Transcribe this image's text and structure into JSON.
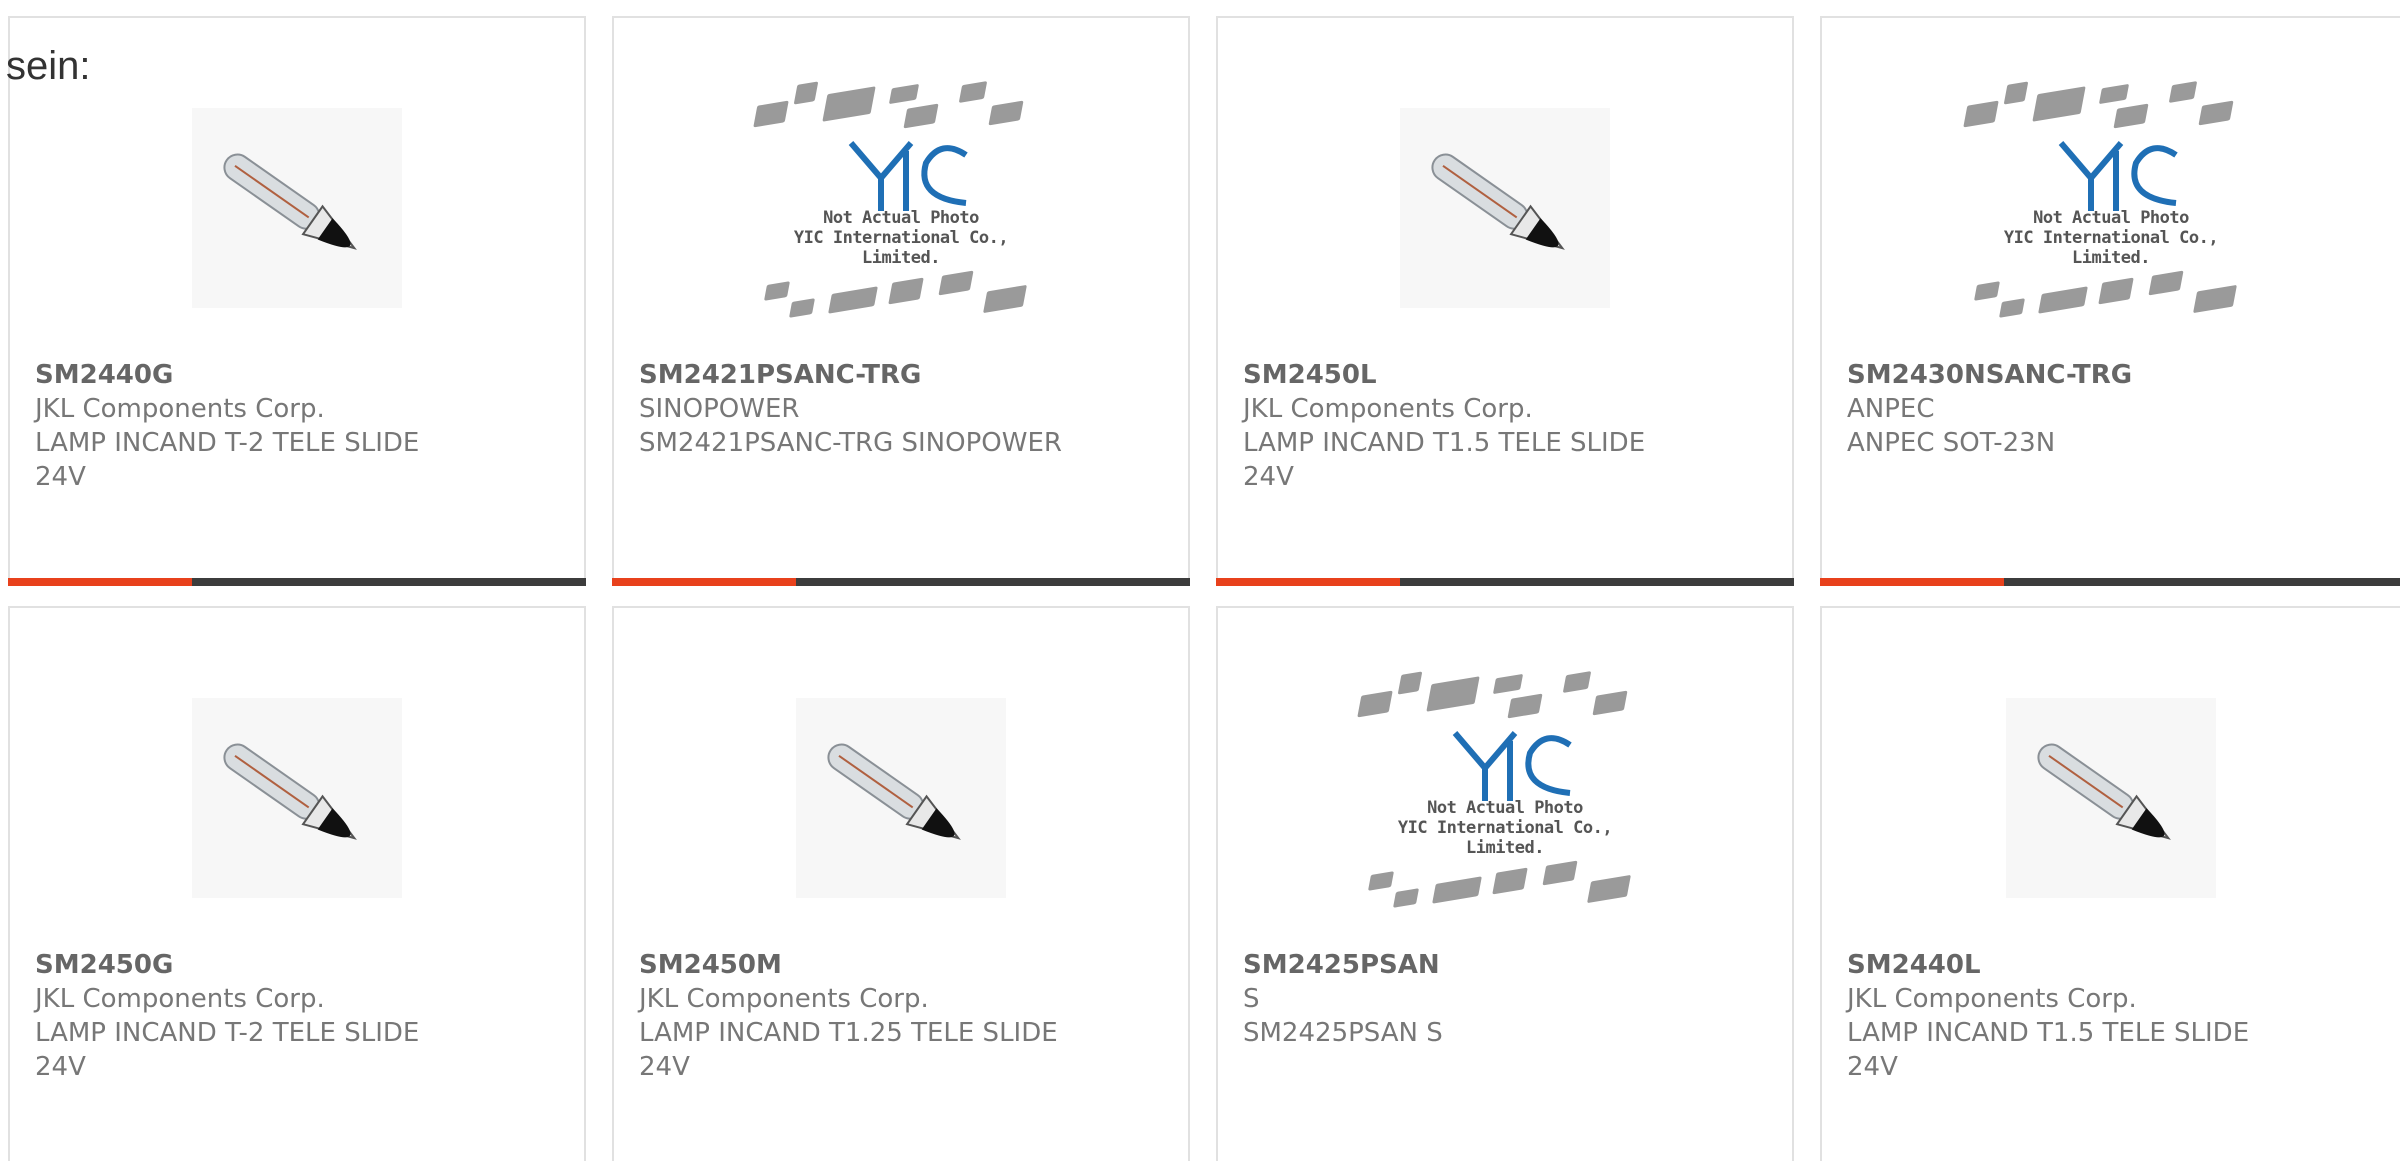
{
  "lead_label": "sein:",
  "colors": {
    "accent": "#e8411c",
    "bar_dark": "#3c3c3c",
    "card_border": "#e1e1e1",
    "logo_blue": "#1f6fb5"
  },
  "placeholder": {
    "line1": "Not Actual Photo",
    "line2": "YIC International Co., Limited."
  },
  "products": [
    {
      "part": "SM2440G",
      "maker": "JKL Components Corp.",
      "desc1": "LAMP INCAND T-2 TELE SLIDE",
      "desc2": "24V",
      "image": "lamp-photo"
    },
    {
      "part": "SM2421PSANC-TRG",
      "maker": "SINOPOWER",
      "desc1": "SM2421PSANC-TRG SINOPOWER",
      "desc2": "",
      "image": "placeholder-logo"
    },
    {
      "part": "SM2450L",
      "maker": "JKL Components Corp.",
      "desc1": "LAMP INCAND T1.5 TELE SLIDE",
      "desc2": "24V",
      "image": "lamp-photo"
    },
    {
      "part": "SM2430NSANC-TRG",
      "maker": "ANPEC",
      "desc1": "ANPEC SOT-23N",
      "desc2": "",
      "image": "placeholder-logo"
    },
    {
      "part": "SM2450G",
      "maker": "JKL Components Corp.",
      "desc1": "LAMP INCAND T-2 TELE SLIDE",
      "desc2": "24V",
      "image": "lamp-photo"
    },
    {
      "part": "SM2450M",
      "maker": "JKL Components Corp.",
      "desc1": "LAMP INCAND T1.25 TELE SLIDE",
      "desc2": "24V",
      "image": "lamp-photo"
    },
    {
      "part": "SM2425PSAN",
      "maker": "S",
      "desc1": "SM2425PSAN S",
      "desc2": "",
      "image": "placeholder-logo"
    },
    {
      "part": "SM2440L",
      "maker": "JKL Components Corp.",
      "desc1": "LAMP INCAND T1.5 TELE SLIDE",
      "desc2": "24V",
      "image": "lamp-photo"
    }
  ]
}
